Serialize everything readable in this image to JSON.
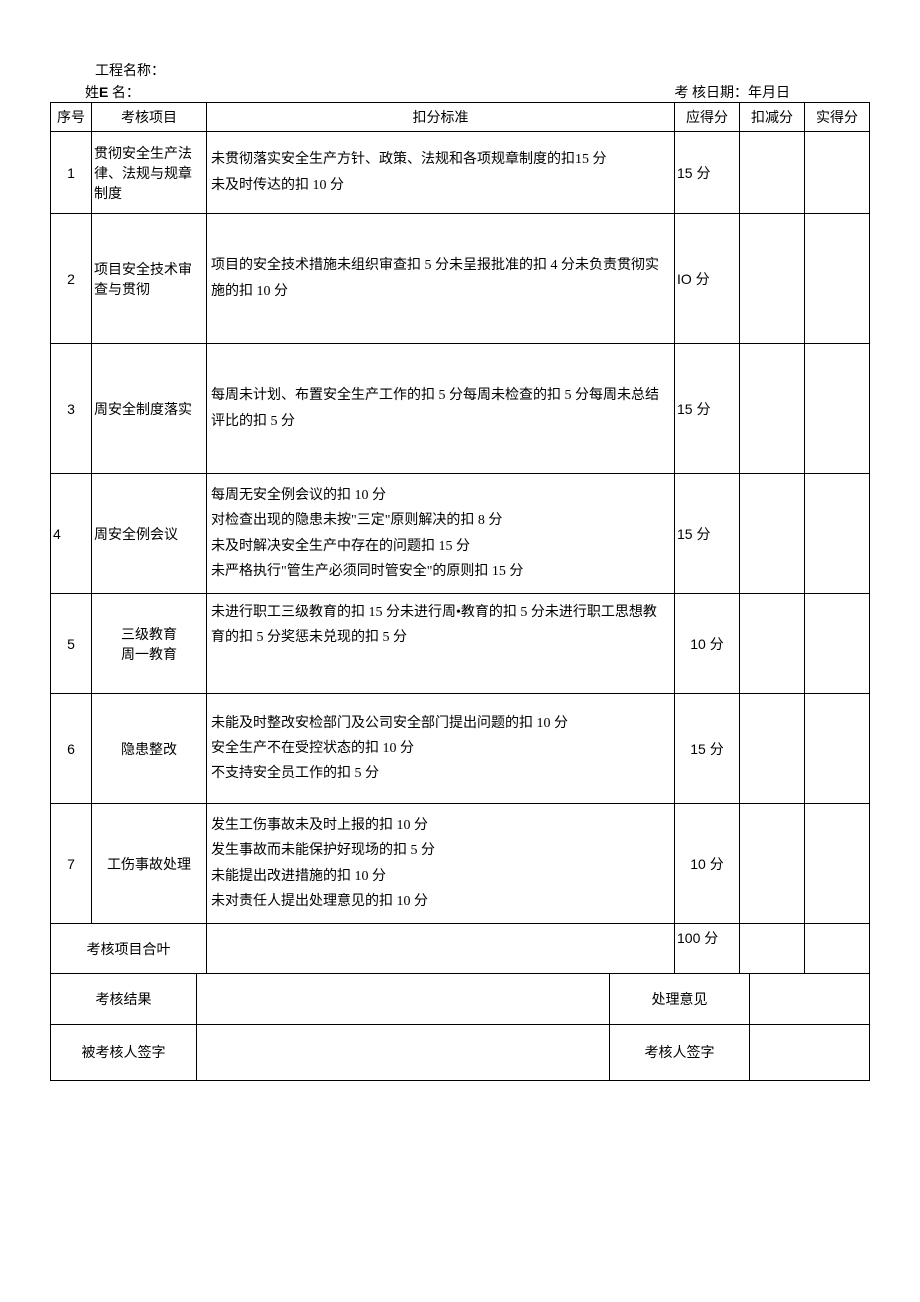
{
  "header": {
    "project_label": "工程名称：",
    "name_label_prefix": "姓",
    "name_label_e": "E",
    "name_label_suffix": " 名：",
    "date_label_prefix": "考",
    "date_label_suffix": "核日期：年月日"
  },
  "columns": {
    "num": "序号",
    "item": "考核项目",
    "standard": "扣分标准",
    "should": "应得分",
    "deduct": "扣减分",
    "actual": "实得分"
  },
  "rows": [
    {
      "num": "1",
      "item": "贯彻安全生产法律、法规与规章制度",
      "standard": "未贯彻落实安全生产方针、政策、法规和各项规章制度的扣15 分\n未及时传达的扣 10 分",
      "should": "15 分"
    },
    {
      "num": "2",
      "item": "项目安全技术审查与贯彻",
      "standard": "项目的安全技术措施未组织审查扣 5 分未呈报批准的扣 4 分未负责贯彻实施的扣 10 分",
      "should": "IO 分"
    },
    {
      "num": "3",
      "item": "周安全制度落实",
      "standard": "每周未计划、布置安全生产工作的扣 5 分每周未检查的扣 5 分每周未总结评比的扣 5 分",
      "should": "15 分"
    },
    {
      "num": "4",
      "item": "周安全例会议",
      "standard": "每周无安全例会议的扣 10 分\n对检查出现的隐患未按\"三定\"原则解决的扣 8 分\n未及时解决安全生产中存在的问题扣 15 分\n未严格执行\"管生产必须同时管安全\"的原则扣 15 分",
      "should": "15 分"
    },
    {
      "num": "5",
      "item": "三级教育\n周一教育",
      "standard": "未进行职工三级教育的扣 15 分未进行周•教育的扣 5 分未进行职工思想教育的扣 5 分奖惩未兑现的扣 5 分",
      "should": "10 分"
    },
    {
      "num": "6",
      "item": "隐患整改",
      "standard": "未能及时整改安检部门及公司安全部门提出问题的扣 10 分\n安全生产不在受控状态的扣 10 分\n不支持安全员工作的扣 5 分",
      "should": "15 分"
    },
    {
      "num": "7",
      "item": "工伤事故处理",
      "standard": "发生工伤事故未及时上报的扣 10 分\n发生事故而未能保护好现场的扣 5 分\n未能提出改进措施的扣 10 分\n未对责任人提出处理意见的扣 10 分",
      "should": "10 分"
    }
  ],
  "footer": {
    "total_label": "考核项目合叶",
    "total_value": "100 分",
    "result_label": "考核结果",
    "opinion_label": "处理意见",
    "assessee_label": "被考核人签字",
    "assessor_label": "考核人签字"
  }
}
